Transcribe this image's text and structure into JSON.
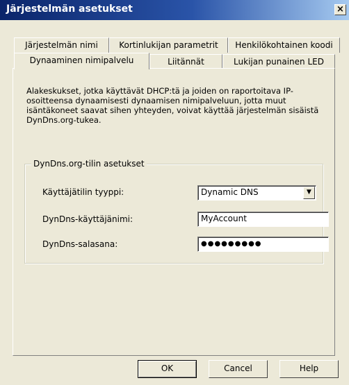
{
  "window": {
    "title": "Järjestelmän asetukset",
    "close_label": "×"
  },
  "tabs": {
    "back_row": [
      {
        "label": "Järjestelmän nimi"
      },
      {
        "label": "Kortinlukijan parametrit"
      },
      {
        "label": "Henkilökohtainen koodi"
      }
    ],
    "front_row": [
      {
        "label": "Dynaaminen nimipalvelu",
        "active": true
      },
      {
        "label": "Liitännät"
      },
      {
        "label": "Lukijan punainen LED"
      }
    ]
  },
  "panel": {
    "description": "Alakeskukset, jotka käyttävät DHCP:tä ja joiden on raportoitava IP-osoitteensa dynaamisesti dynaamisen nimipalveluun, jotta muut isäntäkoneet saavat sihen yhteyden, voivat käyttää järjestelmän sisäistä DynDns.org-tukea.",
    "group": {
      "title": "DynDns.org-tilin asetukset",
      "account_type_label": "Käyttäjätilin tyyppi:",
      "account_type_value": "Dynamic DNS",
      "username_label": "DynDns-käyttäjänimi:",
      "username_value": "MyAccount",
      "password_label": "DynDns-salasana:",
      "password_value": "●●●●●●●●●"
    }
  },
  "buttons": {
    "ok": "OK",
    "cancel": "Cancel",
    "help": "Help"
  },
  "icons": {
    "dropdown": "chevron-down-icon"
  }
}
